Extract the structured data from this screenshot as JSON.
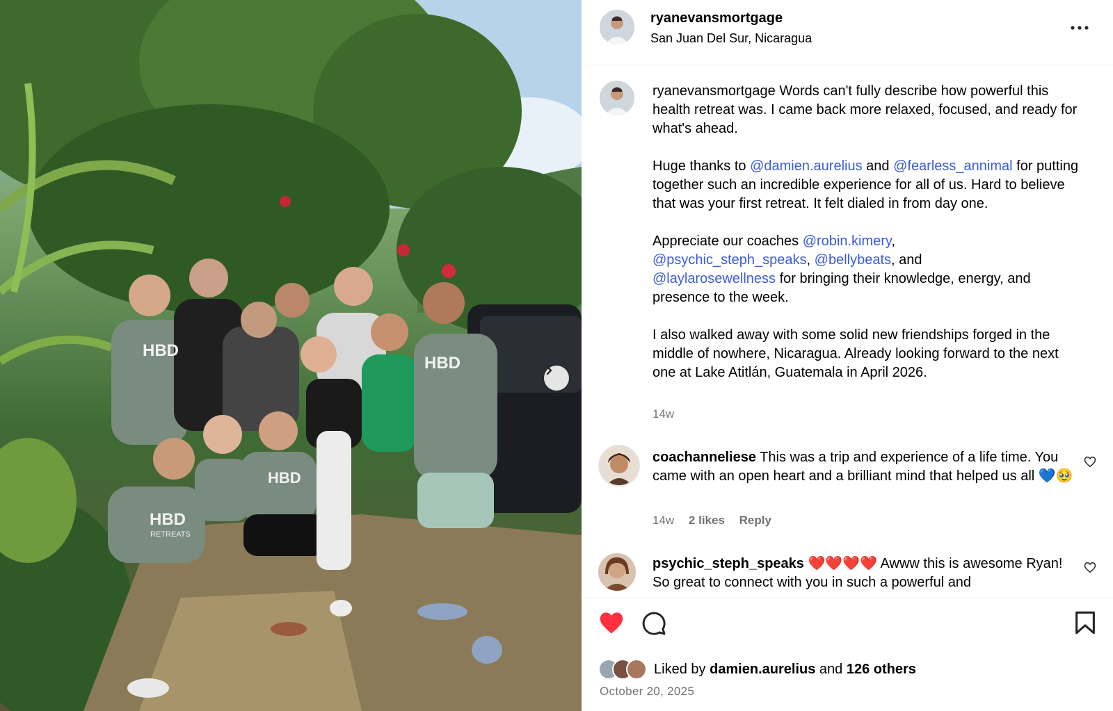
{
  "post": {
    "username": "ryanevansmortgage",
    "location": "San Juan Del Sur, Nicaragua"
  },
  "caption": {
    "username": "ryanevansmortgage",
    "p1": " Words can't fully describe how powerful this health retreat was. I came back more relaxed, focused, and ready for what's ahead.",
    "p2_a": "Huge thanks to ",
    "p2_m1": "@damien.aurelius",
    "p2_b": " and ",
    "p2_m2": "@fearless_annimal",
    "p2_c": " for putting together such an incredible experience for all of us. Hard to believe that was your first retreat. It felt dialed in from day one.",
    "p3_a": "Appreciate our coaches ",
    "p3_m1": "@robin.kimery",
    "p3_b": ", ",
    "p3_m2": "@psychic_steph_speaks",
    "p3_c": ", ",
    "p3_m3": "@bellybeats",
    "p3_d": ", and ",
    "p3_m4": "@laylarosewellness",
    "p3_e": " for bringing their knowledge, energy, and presence to the week.",
    "p4": "I also walked away with some solid new friendships forged in the middle of nowhere, Nicaragua. Already looking forward to the next one at Lake Atitlán, Guatemala in April 2026.",
    "time": "14w"
  },
  "comments": [
    {
      "username": "coachanneliese",
      "text": " This was a trip and experience of a life time. You came with an open heart and a brilliant mind that helped us all 💙🥹",
      "time": "14w",
      "likes": "2 likes",
      "reply": "Reply"
    },
    {
      "username": "psychic_steph_speaks",
      "text": " ❤️❤️❤️❤️ Awww this is awesome Ryan! So great to connect with you in such a powerful and"
    }
  ],
  "engagement": {
    "liked_by_prefix": "Liked by ",
    "liked_by_user": "damien.aurelius",
    "and": " and ",
    "others": "126 others",
    "date": "October 20, 2025"
  },
  "photo": {
    "shirt_text": "HBD",
    "shirt_subtext": "RETREATS"
  },
  "colors": {
    "like_red": "#ff3040",
    "mention_blue": "#3b5bdb",
    "meta_gray": "#737373"
  }
}
